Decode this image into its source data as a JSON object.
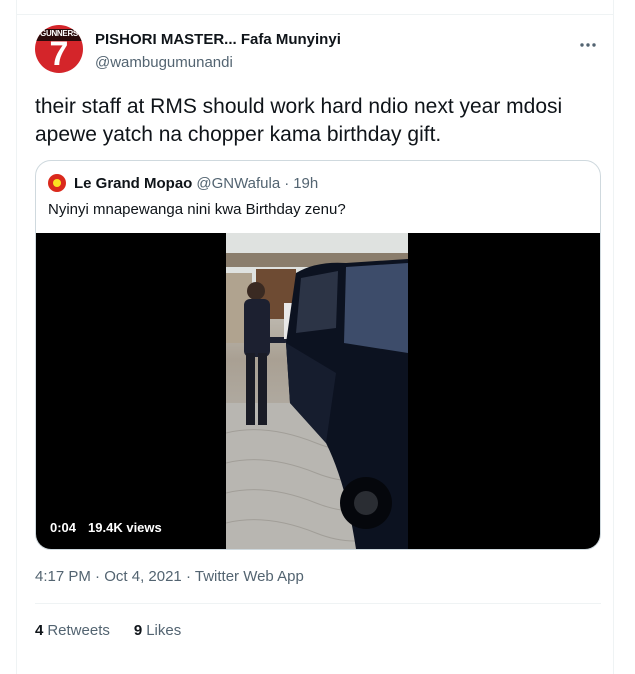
{
  "tweet": {
    "author_name": "PISHORI MASTER... Fafa Munyinyi",
    "author_handle": "@wambugumunandi",
    "avatar_text": "GUNNERS",
    "avatar_number": "7",
    "text": "their staff at RMS should work hard ndio next year mdosi apewe yatch na chopper kama birthday gift.",
    "time": "4:17 PM",
    "date": "Oct 4, 2021",
    "source": "Twitter Web App",
    "retweets_count": "4",
    "retweets_label": "Retweets",
    "likes_count": "9",
    "likes_label": "Likes"
  },
  "quoted": {
    "author_name": "Le Grand Mopao",
    "author_handle": "@GNWafula",
    "time": "19h",
    "text": "Nyinyi mnapewanga nini kwa Birthday zenu?",
    "video_duration": "0:04",
    "video_views": "19.4K views"
  },
  "icons": {
    "more": "more-horizontal-icon",
    "quoted_avatar": "club-crest-icon"
  },
  "colors": {
    "text_primary": "#0f1419",
    "text_secondary": "#536471",
    "border": "#cfd9de",
    "avatar_red": "#d4252a"
  }
}
